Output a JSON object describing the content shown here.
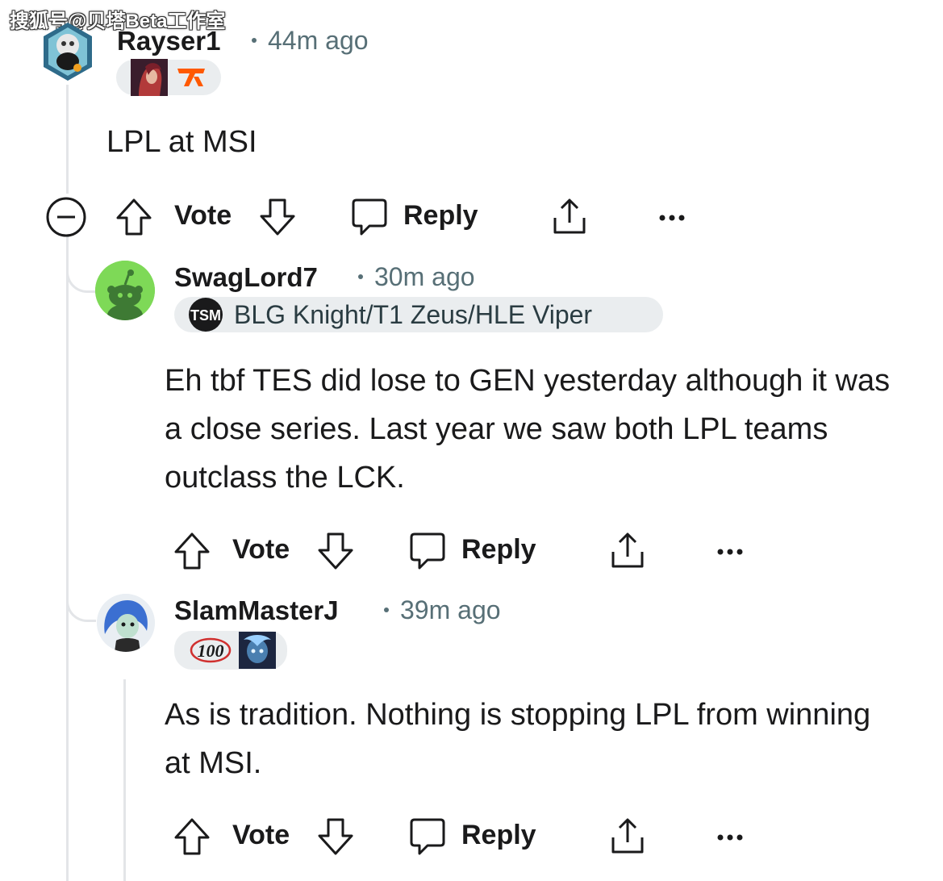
{
  "watermark": "搜狐号@贝塔Beta工作室",
  "comments": [
    {
      "username": "Rayser1",
      "time": "44m ago",
      "body": "LPL at MSI",
      "actions": {
        "vote": "Vote",
        "reply": "Reply"
      }
    },
    {
      "username": "SwagLord7",
      "time": "30m ago",
      "flair_text": "BLG Knight/T1 Zeus/HLE Viper",
      "body": "Eh tbf TES did lose to GEN yesterday although it was a close series. Last year we saw both LPL teams outclass the LCK.",
      "actions": {
        "vote": "Vote",
        "reply": "Reply"
      }
    },
    {
      "username": "SlamMasterJ",
      "time": "39m ago",
      "flair_badge": "100",
      "body": "As is tradition. Nothing is stopping LPL from winning at MSI.",
      "actions": {
        "vote": "Vote",
        "reply": "Reply"
      }
    }
  ],
  "colors": {
    "text": "#1a1a1b",
    "meta": "#576f76",
    "thread_line": "#e3e5e8",
    "flair_bg": "#eaedef",
    "fnatic_orange": "#ff5900",
    "snoo_green": "#7ed957"
  },
  "icons": [
    "collapse-icon",
    "upvote-icon",
    "downvote-icon",
    "reply-icon",
    "share-icon",
    "more-icon"
  ]
}
